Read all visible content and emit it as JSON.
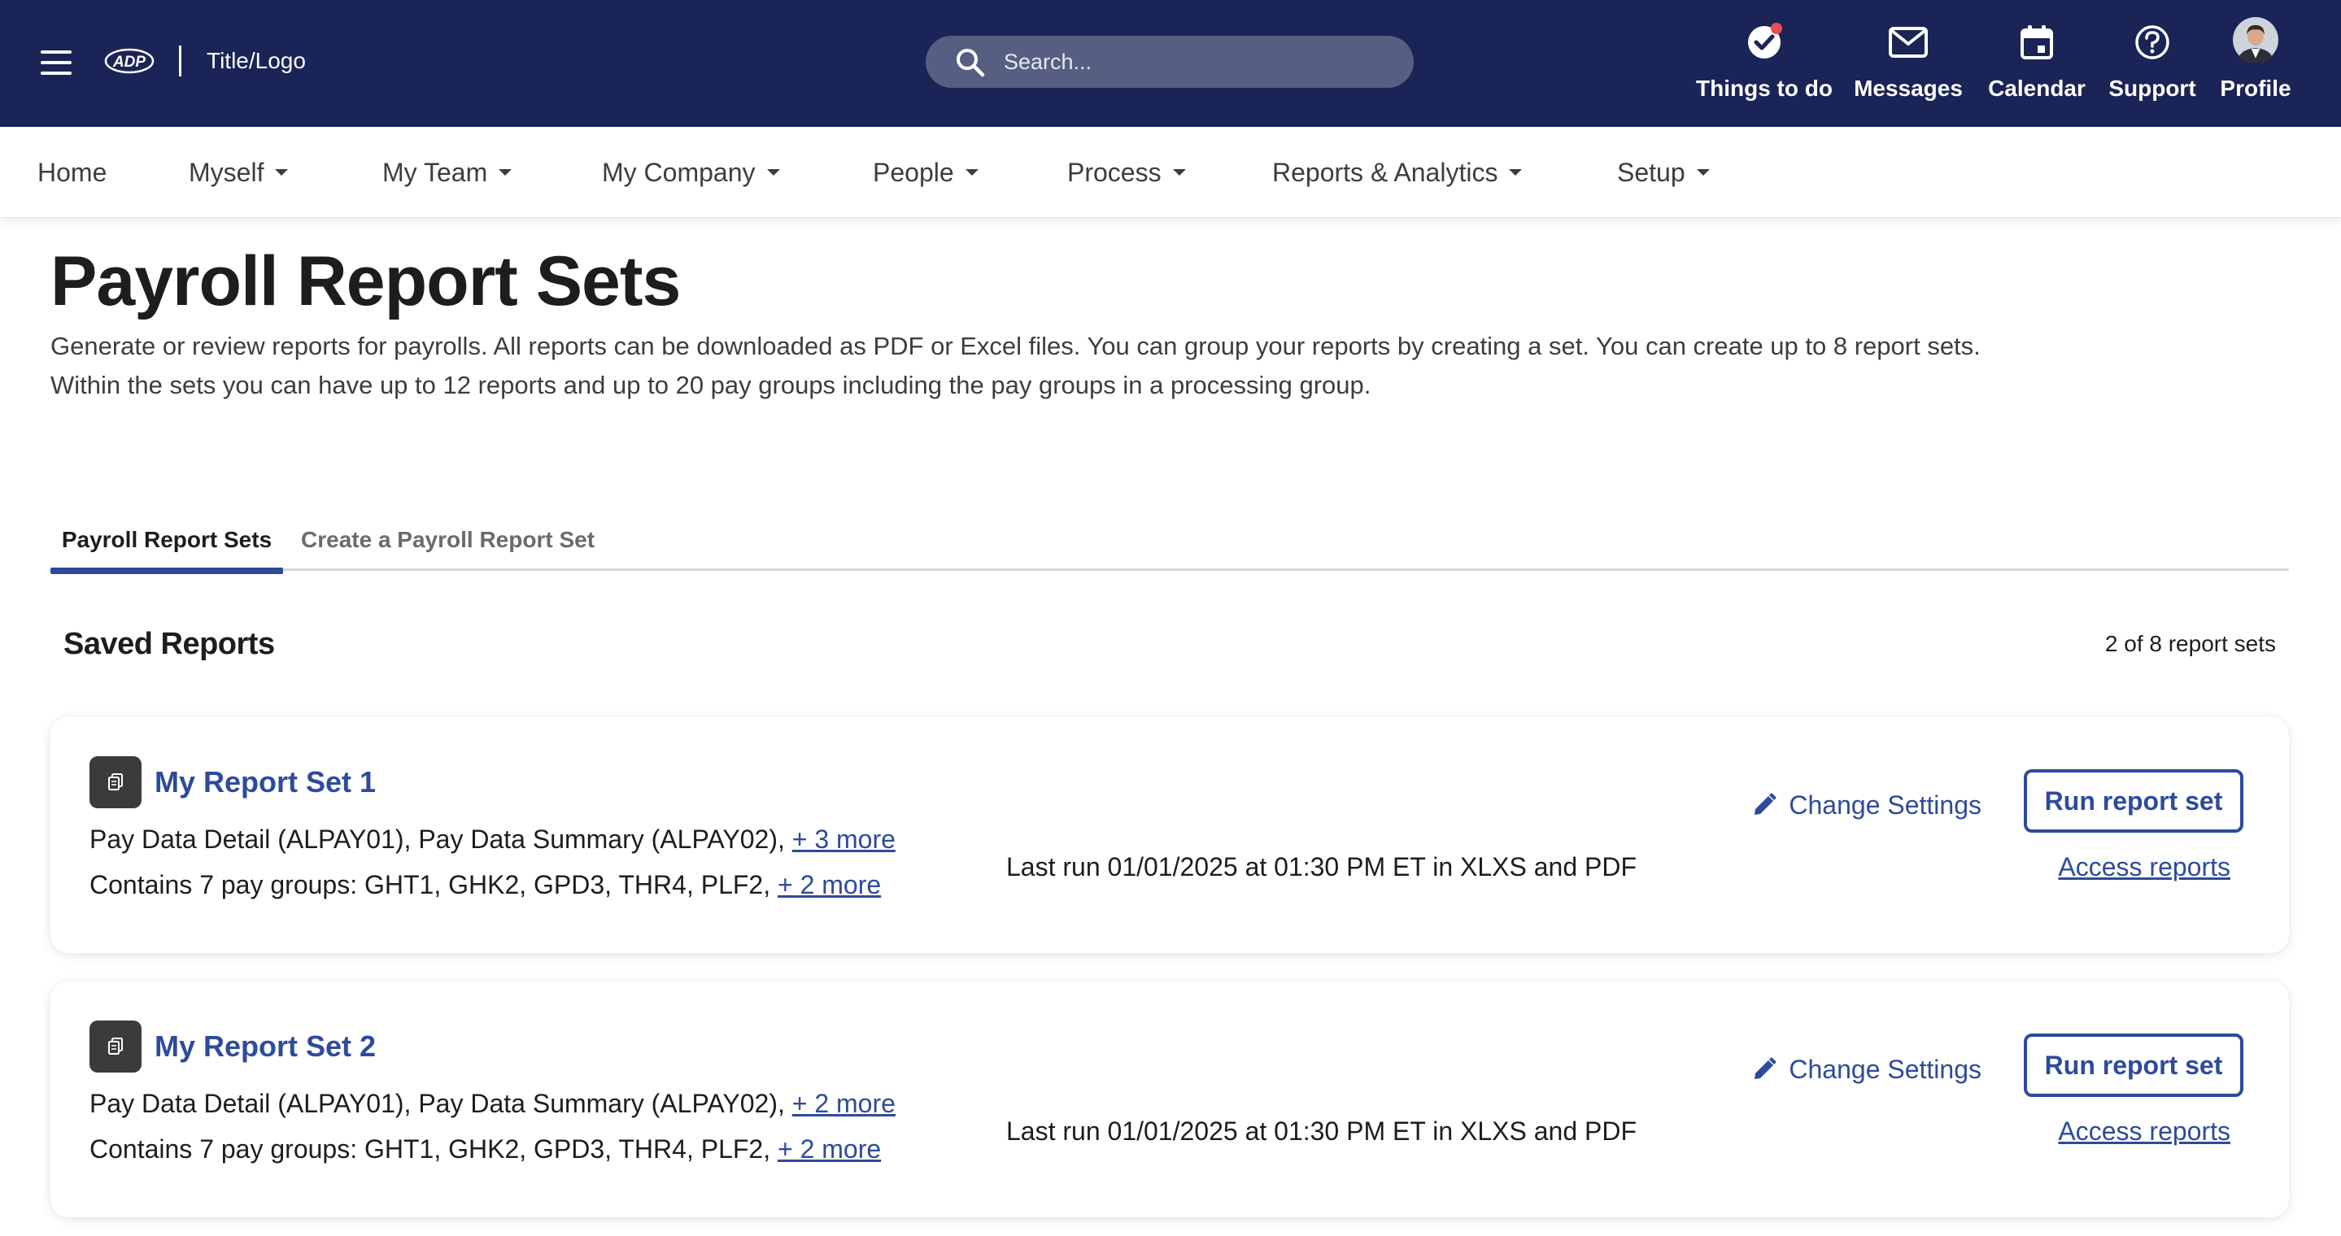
{
  "header": {
    "title_logo": "Title/Logo",
    "search_placeholder": "Search...",
    "actions": [
      {
        "label": "Things to do",
        "icon": "check-circle-icon"
      },
      {
        "label": "Messages",
        "icon": "envelope-icon"
      },
      {
        "label": "Calendar",
        "icon": "calendar-icon"
      },
      {
        "label": "Support",
        "icon": "help-circle-icon"
      },
      {
        "label": "Profile",
        "icon": "avatar"
      }
    ]
  },
  "nav": {
    "items": [
      {
        "label": "Home"
      },
      {
        "label": "Myself"
      },
      {
        "label": "My Team"
      },
      {
        "label": "My Company"
      },
      {
        "label": "People"
      },
      {
        "label": "Process"
      },
      {
        "label": "Reports & Analytics"
      },
      {
        "label": "Setup"
      }
    ]
  },
  "page": {
    "title": "Payroll Report Sets",
    "description": "Generate or review reports for payrolls. All reports can be downloaded as PDF or Excel files. You can group your reports by creating a set. You can create up to 8 report sets. Within the sets you can have up to 12 reports and up to 20 pay groups including the pay groups in a processing group."
  },
  "tabs": [
    {
      "label": "Payroll Report Sets",
      "active": true
    },
    {
      "label": "Create a Payroll Report Set",
      "active": false
    }
  ],
  "saved": {
    "title": "Saved Reports",
    "count": "2 of 8 report sets"
  },
  "report_sets": [
    {
      "title": "My Report Set 1",
      "reports": "Pay Data Detail (ALPAY01), Pay Data Summary (ALPAY02),",
      "reports_more": "+ 3 more",
      "pay_groups": "Contains 7 pay groups: GHT1, GHK2, GPD3, THR4, PLF2,",
      "pay_groups_more": "+ 2 more",
      "change_settings": "Change Settings",
      "run_label": "Run report set",
      "last_run": "Last run 01/01/2025 at 01:30 PM ET in XLXS and PDF",
      "access_label": "Access reports"
    },
    {
      "title": "My Report Set 2",
      "reports": "Pay Data Detail (ALPAY01), Pay Data Summary (ALPAY02),",
      "reports_more": "+ 2 more",
      "pay_groups": "Contains 7 pay groups: GHT1, GHK2, GPD3, THR4, PLF2,",
      "pay_groups_more": "+ 2 more",
      "change_settings": "Change Settings",
      "run_label": "Run report set",
      "last_run": "Last run 01/01/2025 at 01:30 PM ET in XLXS and PDF",
      "access_label": "Access reports"
    }
  ],
  "colors": {
    "header_bg": "#1a2456",
    "search_bg": "#565e82",
    "accent": "#2e4b9b",
    "notification": "#e8514c"
  }
}
